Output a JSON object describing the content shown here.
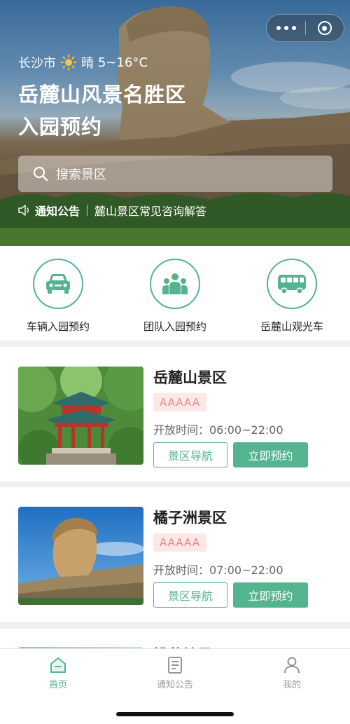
{
  "capsule": {
    "more_icon": "more-dots-icon",
    "close_icon": "mini-program-close-icon"
  },
  "weather": {
    "city": "长沙市",
    "condition": "晴",
    "temp": "5~16°C",
    "icon": "sun-icon"
  },
  "hero": {
    "title_line1": "岳麓山风景名胜区",
    "title_line2": "入园预约"
  },
  "search": {
    "placeholder": "搜索景区",
    "icon": "search-icon"
  },
  "notice": {
    "label": "通知公告",
    "text": "麓山景区常见咨询解答",
    "icon": "speaker-icon"
  },
  "quick_nav": [
    {
      "label": "车辆入园预约",
      "icon": "car-icon"
    },
    {
      "label": "团队入园预约",
      "icon": "group-icon"
    },
    {
      "label": "岳麓山观光车",
      "icon": "bus-icon"
    }
  ],
  "spots": [
    {
      "name": "岳麓山景区",
      "grade": "AAAAA",
      "hours": "开放时间：06:00~22:00",
      "nav_label": "景区导航",
      "book_label": "立即预约"
    },
    {
      "name": "橘子洲景区",
      "grade": "AAAAA",
      "hours": "开放时间：07:00~22:00",
      "nav_label": "景区导航",
      "book_label": "立即预约"
    },
    {
      "name": "桃花岭景区"
    }
  ],
  "tabbar": [
    {
      "label": "首页",
      "icon": "home-icon",
      "active": true
    },
    {
      "label": "通知公告",
      "icon": "notice-doc-icon",
      "active": false
    },
    {
      "label": "我的",
      "icon": "user-icon",
      "active": false
    }
  ],
  "colors": {
    "accent": "#54b48f",
    "grade_bg": "#fde8e8",
    "grade_text": "#f08a8a",
    "text": "#222222",
    "muted": "#666666"
  }
}
